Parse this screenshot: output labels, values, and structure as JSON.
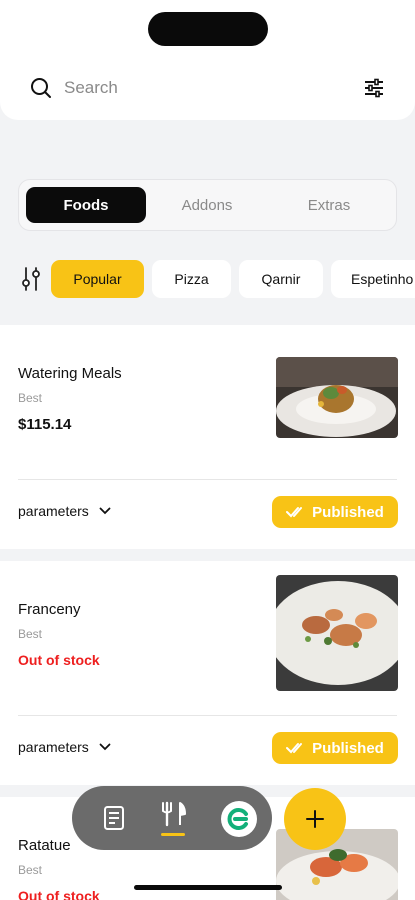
{
  "search": {
    "placeholder": "Search"
  },
  "tabs": [
    {
      "label": "Foods",
      "active": true
    },
    {
      "label": "Addons",
      "active": false
    },
    {
      "label": "Extras",
      "active": false
    }
  ],
  "categories": [
    {
      "label": "Popular",
      "active": true
    },
    {
      "label": "Pizza",
      "active": false
    },
    {
      "label": "Qarnir",
      "active": false
    },
    {
      "label": "Espetinho",
      "active": false
    }
  ],
  "foods": [
    {
      "name": "Watering Meals",
      "tag": "Best",
      "price": "$115.14",
      "status": "Published",
      "params_label": "parameters"
    },
    {
      "name": "Franceny",
      "tag": "Best",
      "stock": "Out of stock",
      "status": "Published",
      "params_label": "parameters"
    },
    {
      "name": "Ratatue",
      "tag": "Best",
      "stock": "Out of stock"
    }
  ],
  "nav": {
    "items": [
      {
        "icon": "orders-document-icon",
        "active": false
      },
      {
        "icon": "fork-knife-icon",
        "active": true
      },
      {
        "icon": "profile-avatar-icon",
        "active": false
      }
    ],
    "fab_icon": "plus-icon"
  },
  "colors": {
    "accent": "#f8c316",
    "dark": "#0b0b0b",
    "out_of_stock": "#ee1f1f",
    "background": "#f2f3f5",
    "nav_bg": "#6b6b6b"
  }
}
